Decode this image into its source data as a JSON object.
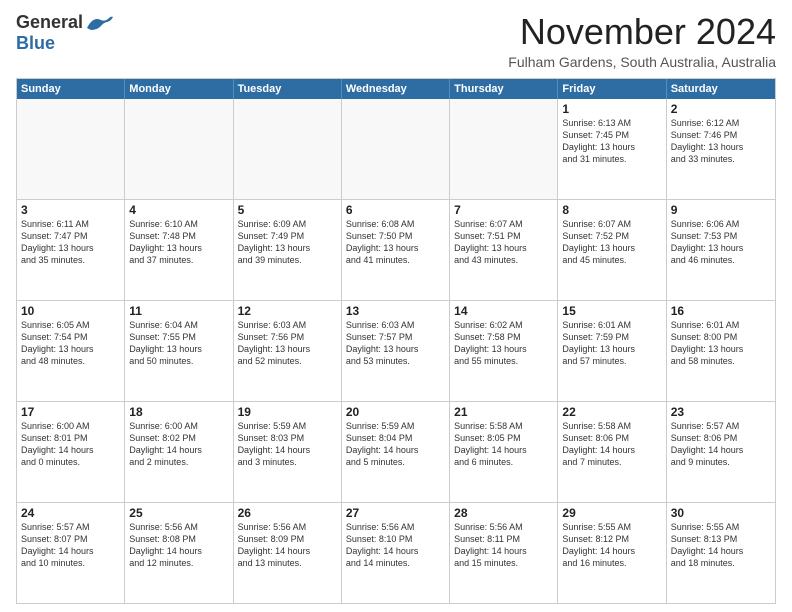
{
  "logo": {
    "general": "General",
    "blue": "Blue"
  },
  "title": "November 2024",
  "subtitle": "Fulham Gardens, South Australia, Australia",
  "days": [
    "Sunday",
    "Monday",
    "Tuesday",
    "Wednesday",
    "Thursday",
    "Friday",
    "Saturday"
  ],
  "weeks": [
    [
      {
        "day": "",
        "text": ""
      },
      {
        "day": "",
        "text": ""
      },
      {
        "day": "",
        "text": ""
      },
      {
        "day": "",
        "text": ""
      },
      {
        "day": "",
        "text": ""
      },
      {
        "day": "1",
        "text": "Sunrise: 6:13 AM\nSunset: 7:45 PM\nDaylight: 13 hours\nand 31 minutes."
      },
      {
        "day": "2",
        "text": "Sunrise: 6:12 AM\nSunset: 7:46 PM\nDaylight: 13 hours\nand 33 minutes."
      }
    ],
    [
      {
        "day": "3",
        "text": "Sunrise: 6:11 AM\nSunset: 7:47 PM\nDaylight: 13 hours\nand 35 minutes."
      },
      {
        "day": "4",
        "text": "Sunrise: 6:10 AM\nSunset: 7:48 PM\nDaylight: 13 hours\nand 37 minutes."
      },
      {
        "day": "5",
        "text": "Sunrise: 6:09 AM\nSunset: 7:49 PM\nDaylight: 13 hours\nand 39 minutes."
      },
      {
        "day": "6",
        "text": "Sunrise: 6:08 AM\nSunset: 7:50 PM\nDaylight: 13 hours\nand 41 minutes."
      },
      {
        "day": "7",
        "text": "Sunrise: 6:07 AM\nSunset: 7:51 PM\nDaylight: 13 hours\nand 43 minutes."
      },
      {
        "day": "8",
        "text": "Sunrise: 6:07 AM\nSunset: 7:52 PM\nDaylight: 13 hours\nand 45 minutes."
      },
      {
        "day": "9",
        "text": "Sunrise: 6:06 AM\nSunset: 7:53 PM\nDaylight: 13 hours\nand 46 minutes."
      }
    ],
    [
      {
        "day": "10",
        "text": "Sunrise: 6:05 AM\nSunset: 7:54 PM\nDaylight: 13 hours\nand 48 minutes."
      },
      {
        "day": "11",
        "text": "Sunrise: 6:04 AM\nSunset: 7:55 PM\nDaylight: 13 hours\nand 50 minutes."
      },
      {
        "day": "12",
        "text": "Sunrise: 6:03 AM\nSunset: 7:56 PM\nDaylight: 13 hours\nand 52 minutes."
      },
      {
        "day": "13",
        "text": "Sunrise: 6:03 AM\nSunset: 7:57 PM\nDaylight: 13 hours\nand 53 minutes."
      },
      {
        "day": "14",
        "text": "Sunrise: 6:02 AM\nSunset: 7:58 PM\nDaylight: 13 hours\nand 55 minutes."
      },
      {
        "day": "15",
        "text": "Sunrise: 6:01 AM\nSunset: 7:59 PM\nDaylight: 13 hours\nand 57 minutes."
      },
      {
        "day": "16",
        "text": "Sunrise: 6:01 AM\nSunset: 8:00 PM\nDaylight: 13 hours\nand 58 minutes."
      }
    ],
    [
      {
        "day": "17",
        "text": "Sunrise: 6:00 AM\nSunset: 8:01 PM\nDaylight: 14 hours\nand 0 minutes."
      },
      {
        "day": "18",
        "text": "Sunrise: 6:00 AM\nSunset: 8:02 PM\nDaylight: 14 hours\nand 2 minutes."
      },
      {
        "day": "19",
        "text": "Sunrise: 5:59 AM\nSunset: 8:03 PM\nDaylight: 14 hours\nand 3 minutes."
      },
      {
        "day": "20",
        "text": "Sunrise: 5:59 AM\nSunset: 8:04 PM\nDaylight: 14 hours\nand 5 minutes."
      },
      {
        "day": "21",
        "text": "Sunrise: 5:58 AM\nSunset: 8:05 PM\nDaylight: 14 hours\nand 6 minutes."
      },
      {
        "day": "22",
        "text": "Sunrise: 5:58 AM\nSunset: 8:06 PM\nDaylight: 14 hours\nand 7 minutes."
      },
      {
        "day": "23",
        "text": "Sunrise: 5:57 AM\nSunset: 8:06 PM\nDaylight: 14 hours\nand 9 minutes."
      }
    ],
    [
      {
        "day": "24",
        "text": "Sunrise: 5:57 AM\nSunset: 8:07 PM\nDaylight: 14 hours\nand 10 minutes."
      },
      {
        "day": "25",
        "text": "Sunrise: 5:56 AM\nSunset: 8:08 PM\nDaylight: 14 hours\nand 12 minutes."
      },
      {
        "day": "26",
        "text": "Sunrise: 5:56 AM\nSunset: 8:09 PM\nDaylight: 14 hours\nand 13 minutes."
      },
      {
        "day": "27",
        "text": "Sunrise: 5:56 AM\nSunset: 8:10 PM\nDaylight: 14 hours\nand 14 minutes."
      },
      {
        "day": "28",
        "text": "Sunrise: 5:56 AM\nSunset: 8:11 PM\nDaylight: 14 hours\nand 15 minutes."
      },
      {
        "day": "29",
        "text": "Sunrise: 5:55 AM\nSunset: 8:12 PM\nDaylight: 14 hours\nand 16 minutes."
      },
      {
        "day": "30",
        "text": "Sunrise: 5:55 AM\nSunset: 8:13 PM\nDaylight: 14 hours\nand 18 minutes."
      }
    ]
  ]
}
